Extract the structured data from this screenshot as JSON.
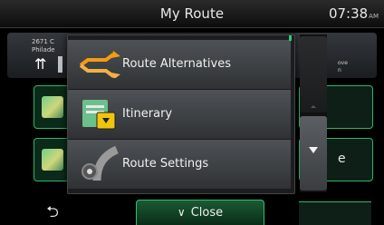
{
  "header": {
    "title": "My Route",
    "clock": "07:38",
    "ampm": "AM"
  },
  "background": {
    "address_line1": "2671 C",
    "address_line2": "Philade",
    "right_text": "e",
    "right_small_line1": "ove",
    "right_small_line2": "n"
  },
  "menu": {
    "items": [
      {
        "label": "Route Alternatives",
        "icon": "route-alternatives-icon"
      },
      {
        "label": "Itinerary",
        "icon": "itinerary-icon"
      },
      {
        "label": "Route Settings",
        "icon": "route-settings-icon"
      }
    ],
    "close_label": "Close"
  },
  "colors": {
    "accent": "#2fbf6a",
    "menu_item": "#4e5256"
  }
}
